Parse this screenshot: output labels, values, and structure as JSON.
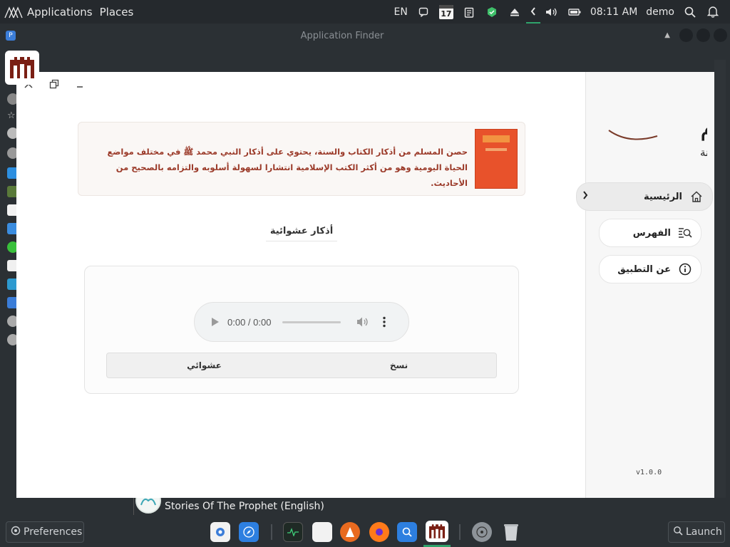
{
  "top_panel": {
    "menu_items": [
      "Applications",
      "Places"
    ],
    "keyboard_layout": "EN",
    "calendar_day": "17",
    "clock": "08:11 AM",
    "user": "demo"
  },
  "finder": {
    "title": "Application Finder"
  },
  "app": {
    "brand_title": "حصن المسلم",
    "brand_subtitle": "من أذكار الكتاب والسنة",
    "intro_text": "حصن المسلم من أذكار الكتاب والسنة، يحتوي على أذكار النبي محمد ﷺ في مختلف مواضع الحياة اليومية وهو من أكثر الكتب الإسلامية انتشارا لسهولة أسلوبه والتزامه بالصحيح من الأحاديث.",
    "section_title": "أذكار عشوائية",
    "audio": {
      "time": "0:00 / 0:00"
    },
    "tabs": [
      "نسخ",
      "عشوائي"
    ],
    "nav": [
      {
        "label": "الرئيسية",
        "icon": "home-icon",
        "active": true
      },
      {
        "label": "الفهرس",
        "icon": "index-search-icon",
        "active": false
      },
      {
        "label": "عن التطبيق",
        "icon": "info-icon",
        "active": false
      }
    ],
    "version": "v1.0.0"
  },
  "behind_window": {
    "stories_label": "Stories Of The Prophet (English)"
  },
  "dock": {
    "preferences_label": "Preferences",
    "launch_label": "Launch"
  },
  "colors": {
    "accent_text": "#9b3a29",
    "book_cover": "#e8522b",
    "panel_bg": "#25292d",
    "dock_indicator": "#2fa36b"
  }
}
